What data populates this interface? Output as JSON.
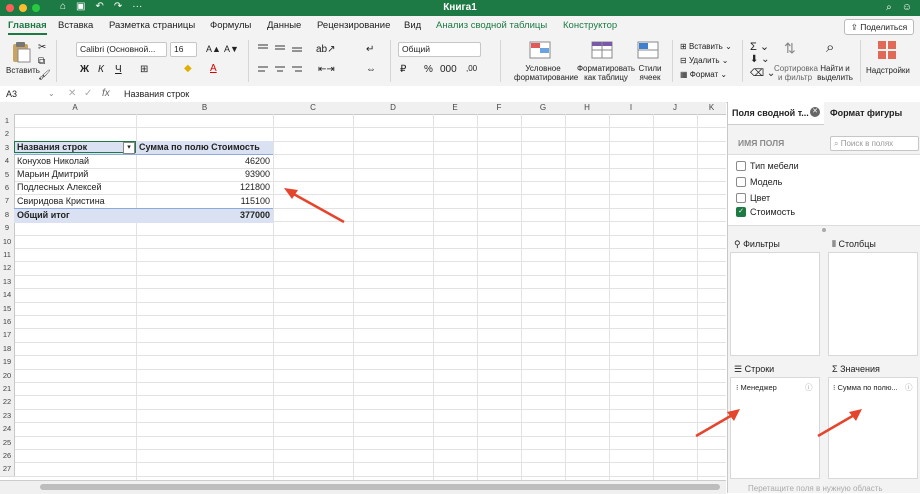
{
  "window": {
    "title": "Книга1"
  },
  "tabs": [
    "Главная",
    "Вставка",
    "Разметка страницы",
    "Формулы",
    "Данные",
    "Рецензирование",
    "Вид",
    "Анализ сводной таблицы",
    "Конструктор"
  ],
  "share_label": "Поделиться",
  "ribbon": {
    "paste_label": "Вставить",
    "font_name": "Calibri (Основной...",
    "font_size": "16",
    "bold": "Ж",
    "italic": "К",
    "underline": "Ч",
    "number_format": "Общий",
    "percent": "%",
    "conditional_formatting": [
      "Условное",
      "форматирование"
    ],
    "format_as_table": [
      "Форматировать",
      "как таблицу"
    ],
    "cell_styles": [
      "Стили",
      "ячеек"
    ],
    "insert": "Вставить",
    "delete": "Удалить",
    "format": "Формат",
    "sort_filter": [
      "Сортировка",
      "и фильтр"
    ],
    "find_select": [
      "Найти и",
      "выделить"
    ],
    "addins": "Надстройки"
  },
  "formula_bar": {
    "cell_ref": "A3",
    "fx": "fx",
    "content": "Названия строк"
  },
  "columns": [
    "A",
    "B",
    "C",
    "D",
    "E",
    "F",
    "G",
    "H",
    "I",
    "J",
    "K"
  ],
  "rows": [
    "1",
    "2",
    "3",
    "4",
    "5",
    "6",
    "7",
    "8",
    "9",
    "10",
    "11",
    "12",
    "13",
    "14",
    "15",
    "16",
    "17",
    "18",
    "19",
    "20",
    "21",
    "22",
    "23",
    "24",
    "25",
    "26",
    "27"
  ],
  "pivot": {
    "header_rows": "Названия строк",
    "header_values": "Сумма по полю Стоимость",
    "rows": [
      {
        "name": "Конухов Николай",
        "value": "46200"
      },
      {
        "name": "Марьин Дмитрий",
        "value": "93900"
      },
      {
        "name": "Подлесных Алексей",
        "value": "121800"
      },
      {
        "name": "Свиридова Кристина",
        "value": "115100"
      }
    ],
    "total_label": "Общий итог",
    "total_value": "377000"
  },
  "panel": {
    "tab_fields": "Поля сводной т...",
    "tab_format": "Формат фигуры",
    "field_name_header": "ИМЯ ПОЛЯ",
    "search_placeholder": "Поиск в полях",
    "fields": [
      {
        "label": "Тип мебели",
        "checked": false
      },
      {
        "label": "Модель",
        "checked": false
      },
      {
        "label": "Цвет",
        "checked": false
      },
      {
        "label": "Стоимость",
        "checked": true
      }
    ],
    "filters_label": "Фильтры",
    "columns_label": "Столбцы",
    "rows_label": "Строки",
    "values_label": "Значения",
    "rows_chip": "Менеджер",
    "values_chip": "Сумма по полю...",
    "drag_hint": "Перетащите поля в нужную область"
  },
  "colors": {
    "accent": "#1e7a44",
    "pivot_header": "#d9e1f2",
    "arrow": "#e5452c"
  }
}
